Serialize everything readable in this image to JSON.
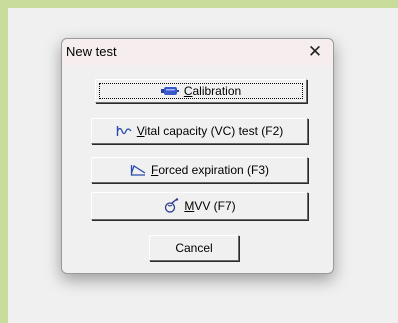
{
  "dialog": {
    "title": "New test",
    "close_glyph": "✕",
    "buttons": [
      {
        "mnemonic": "C",
        "rest": "alibration",
        "icon": "calibration-syringe-icon"
      },
      {
        "mnemonic": "V",
        "rest": "ital capacity (VC) test (F2)",
        "icon": "vital-capacity-icon"
      },
      {
        "mnemonic": "F",
        "rest": "orced expiration (F3)",
        "icon": "forced-expiration-icon"
      },
      {
        "mnemonic": "M",
        "rest": "VV (F7)",
        "icon": "mvv-icon"
      }
    ],
    "cancel_label": "Cancel"
  }
}
